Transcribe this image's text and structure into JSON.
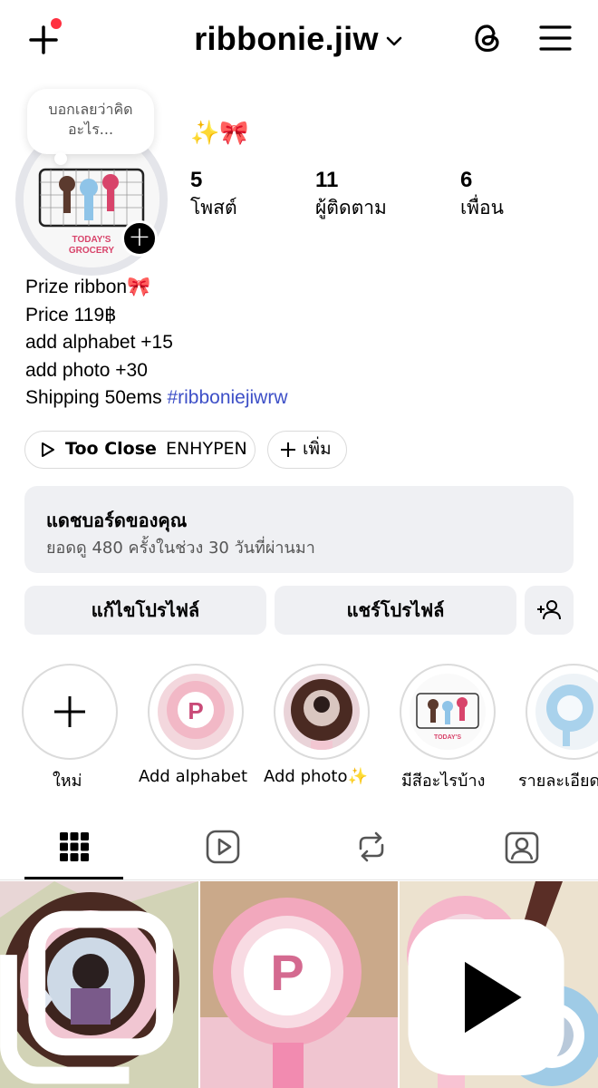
{
  "header": {
    "username": "ribbonie.jiw",
    "create_icon": "plus-icon",
    "threads_icon": "threads-icon",
    "menu_icon": "hamburger-menu-icon",
    "notification_dot_color": "#ff3040"
  },
  "profile": {
    "note_text_line1": "บอกเลยว่าคิด",
    "note_text_line2": "อะไร...",
    "avatar_line1": "TODAY'S",
    "avatar_line2": "GROCERY",
    "name_emoji": "✨🎀",
    "stats": [
      {
        "value": "5",
        "label": "โพสต์"
      },
      {
        "value": "11",
        "label": "ผู้ติดตาม"
      },
      {
        "value": "6",
        "label": "เพื่อน"
      }
    ],
    "bio": {
      "line1": "Prize ribbon",
      "line1_emoji": "🎀",
      "line2": "Price 119฿",
      "line3": "add alphabet +15",
      "line4": "add photo +30",
      "line5_text": "Shipping 50ems ",
      "line5_tag": "#ribboniejiwrw"
    }
  },
  "music": {
    "song": "Too Close",
    "artist": "ENHYPEN",
    "add_label": "เพิ่ม"
  },
  "dashboard": {
    "title": "แดชบอร์ดของคุณ",
    "subtitle": "ยอดดู 480 ครั้งในช่วง 30 วันที่ผ่านมา"
  },
  "buttons": {
    "edit_profile": "แก้ไขโปรไฟล์",
    "share_profile": "แชร์โปรไฟล์"
  },
  "highlights": [
    {
      "label": "ใหม่"
    },
    {
      "label": "Add alphabet"
    },
    {
      "label": "Add photo✨"
    },
    {
      "label": "มีสีอะไรบ้าง"
    },
    {
      "label": "รายละเอียด"
    }
  ],
  "tabs": [
    "grid-icon",
    "reels-icon",
    "reposts-icon",
    "tagged-icon"
  ]
}
